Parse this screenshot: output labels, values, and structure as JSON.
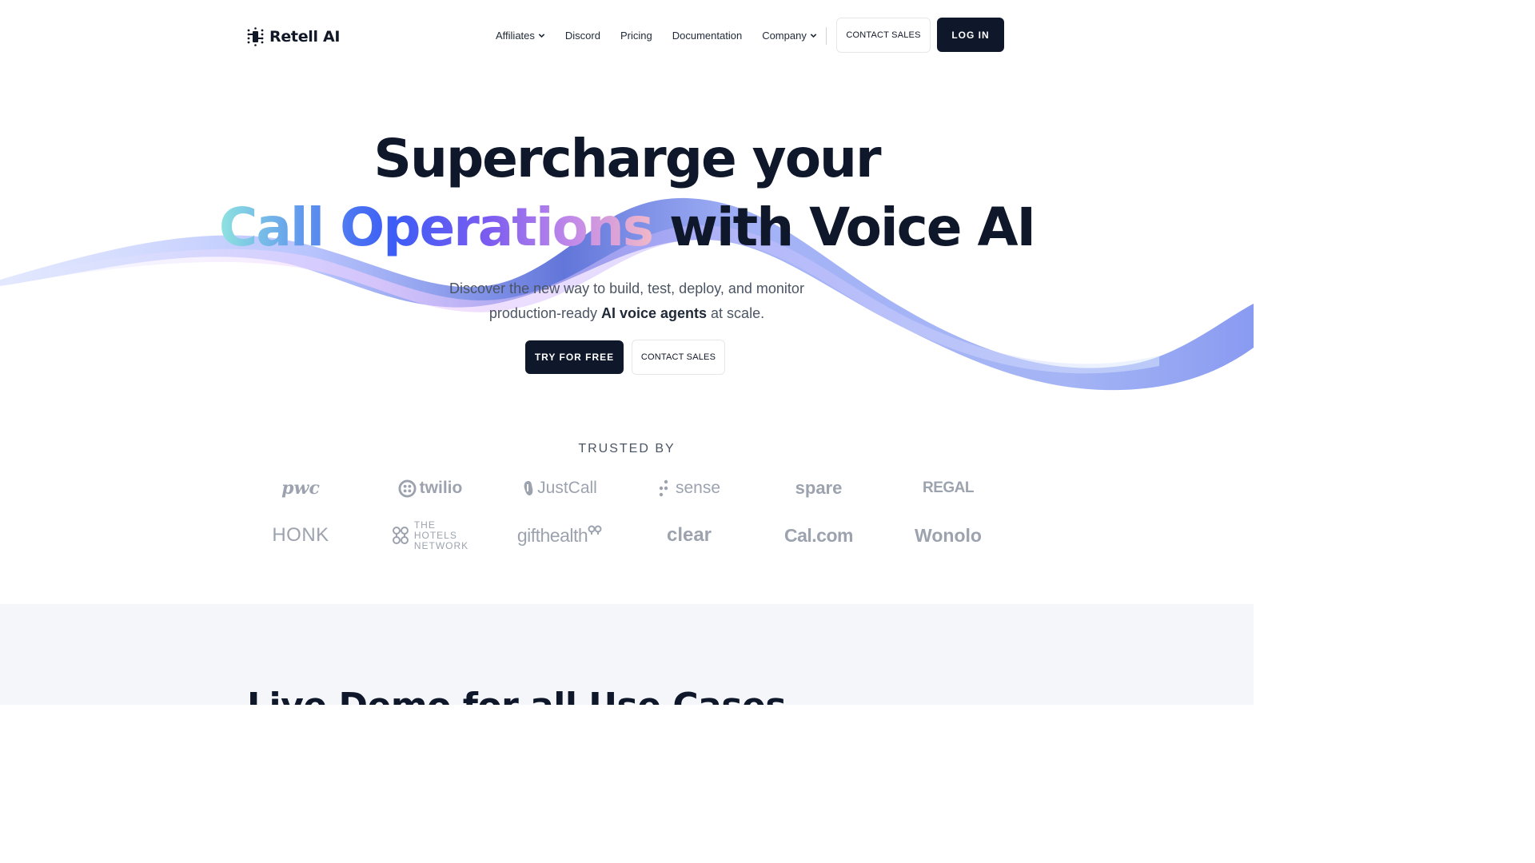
{
  "nav": {
    "brand": "Retell AI",
    "links": [
      {
        "label": "Affiliates",
        "has_dropdown": true
      },
      {
        "label": "Discord",
        "has_dropdown": false
      },
      {
        "label": "Pricing",
        "has_dropdown": false
      },
      {
        "label": "Documentation",
        "has_dropdown": false
      },
      {
        "label": "Company",
        "has_dropdown": true
      }
    ],
    "contact_label": "CONTACT SALES",
    "login_label": "LOG IN"
  },
  "hero": {
    "line1": "Supercharge your",
    "line2_gradient": "Call Operations",
    "line2_rest": " with Voice AI",
    "sub_part1": "Discover the new way to build, test, deploy, and monitor",
    "sub_part2": "production-ready ",
    "sub_bold": "AI voice agents",
    "sub_part3": " at scale.",
    "try_label": "TRY FOR FREE",
    "contact_label": "CONTACT SALES"
  },
  "trusted": {
    "heading": "TRUSTED BY",
    "logos": [
      "pwc",
      "twilio",
      "JustCall",
      "sense",
      "spare",
      "REGAL",
      "HONK",
      "THE HOTELS NETWORK",
      "gifthealth",
      "clear",
      "Cal.com",
      "Wonolo"
    ],
    "hotels_lines": [
      "THE",
      "HOTELS",
      "NETWORK"
    ]
  },
  "section2": {
    "title": "Live Demo for all Use Cases"
  },
  "colors": {
    "dark": "#0f172a",
    "muted": "#9ca3af",
    "gradient": [
      "#8ee3e0",
      "#3b5cf6",
      "#c48be8",
      "#f0b8c8"
    ]
  }
}
